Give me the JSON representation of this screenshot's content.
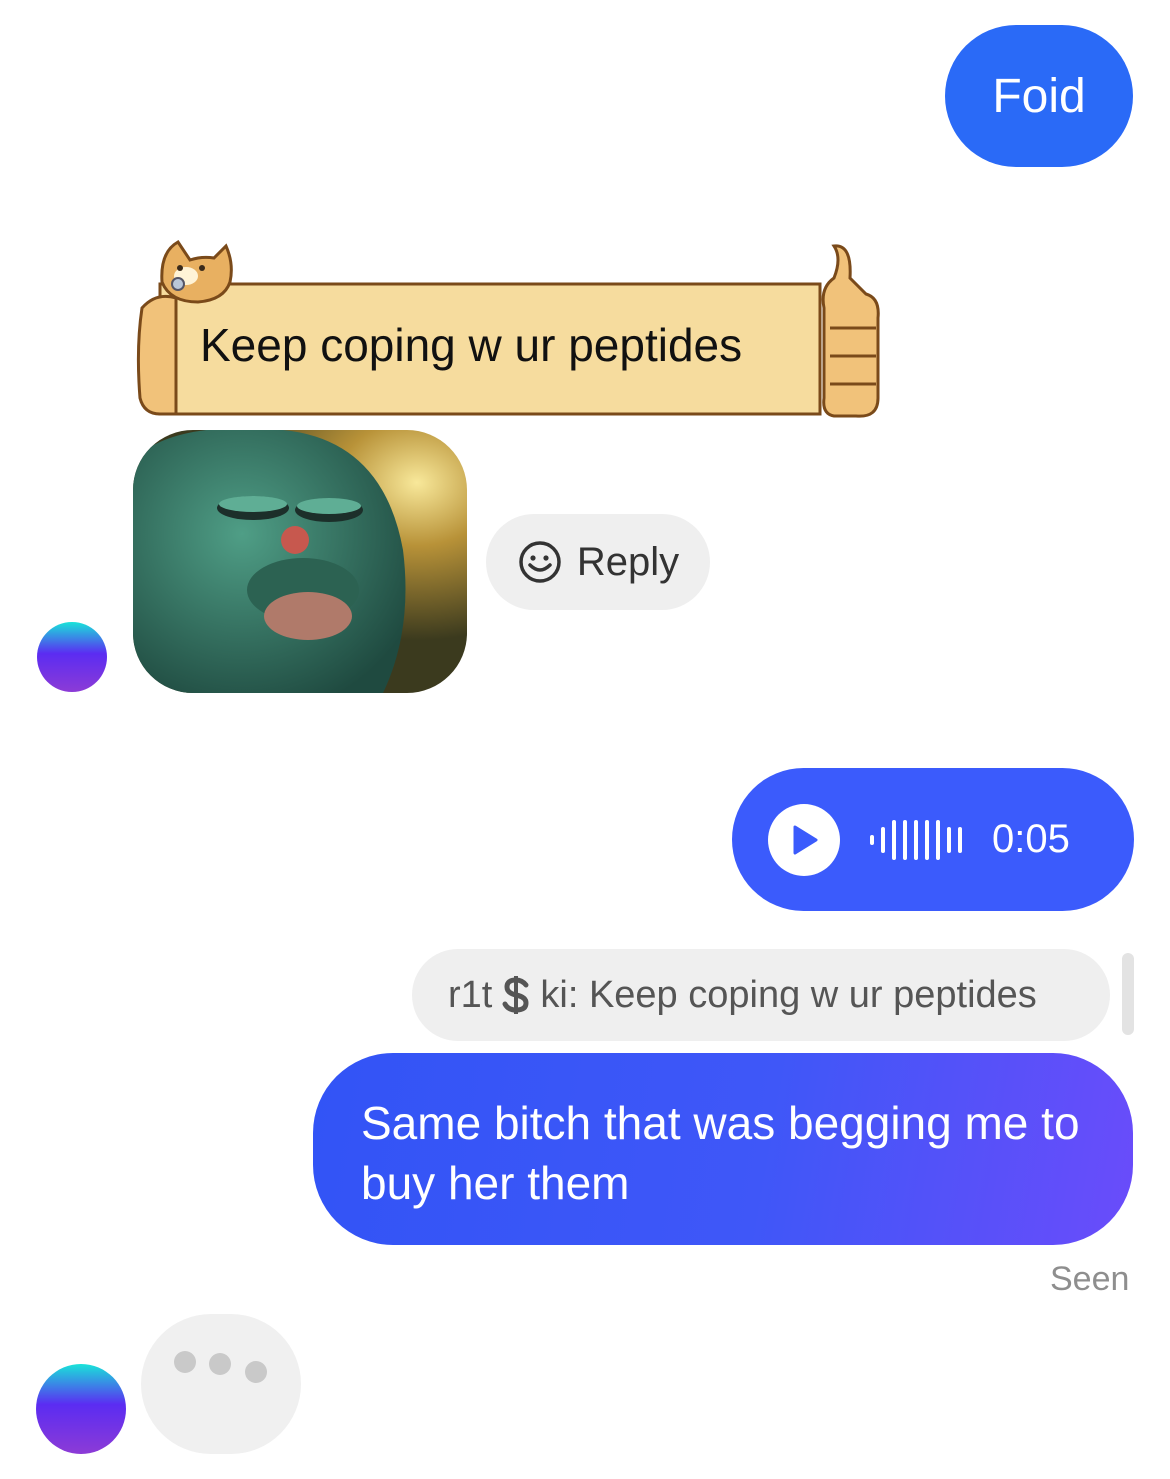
{
  "messages": {
    "outgoing_1": {
      "text": "Foid"
    },
    "incoming_sticker": {
      "text": "Keep coping w ur peptides"
    },
    "incoming_image": {
      "alt": "frog meme"
    },
    "reply_button": {
      "label": "Reply"
    },
    "voice_message": {
      "duration": "0:05"
    },
    "quoted_reply": {
      "sender": "r1t",
      "sender_suffix": "ki",
      "text": "Keep coping w ur peptides"
    },
    "outgoing_2": {
      "text": "Same bitch that was begging me to buy her them"
    },
    "status": {
      "text": "Seen"
    }
  },
  "colors": {
    "outgoing_bubble": "#2a6af7",
    "voice_bubble": "#3b5bfc",
    "reply_bg": "#efefef",
    "seen_text": "#8e8e8e"
  },
  "icons": {
    "reply": "smile-reply-icon",
    "play": "play-icon",
    "waveform": "waveform-icon",
    "dollar": "dollar-icon"
  }
}
